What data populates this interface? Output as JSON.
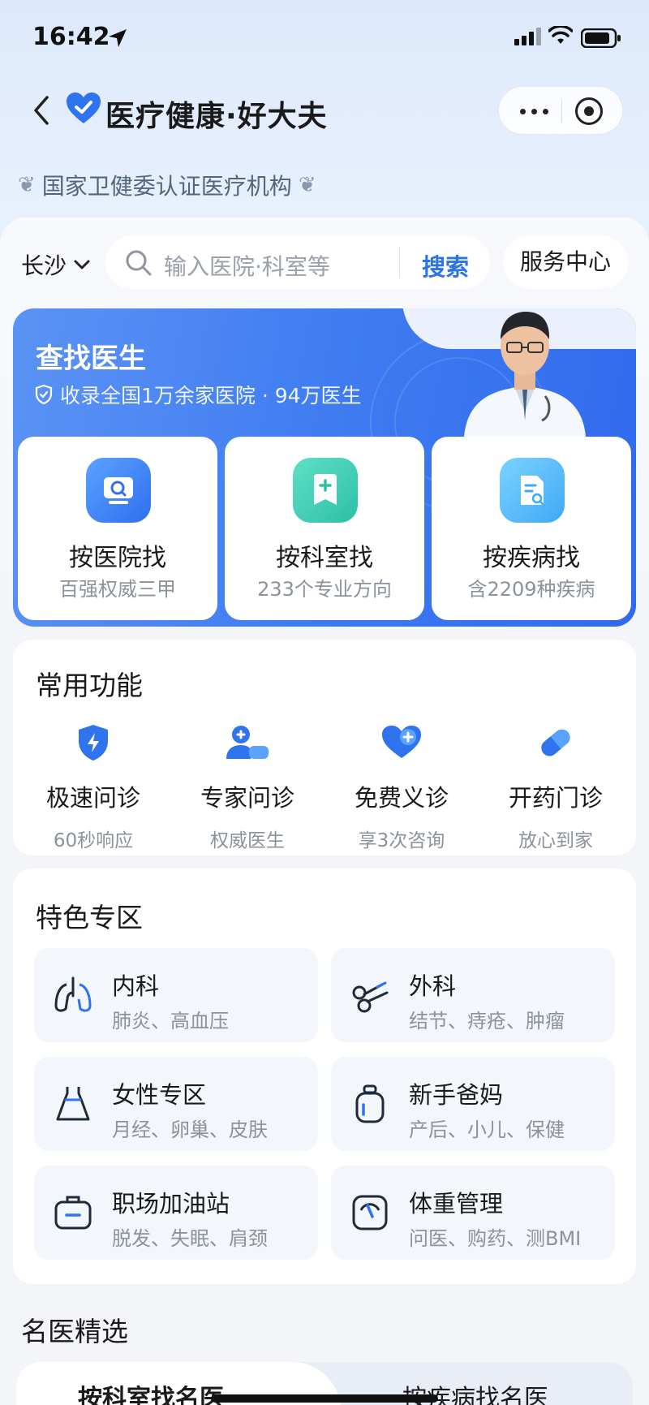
{
  "status_bar": {
    "time": "16:42"
  },
  "nav": {
    "brand": "医疗健康·好大夫"
  },
  "certification": "国家卫健委认证医疗机构",
  "search": {
    "city": "长沙",
    "placeholder": "输入医院·科室等",
    "button": "搜索",
    "service_center": "服务中心"
  },
  "find_doctor": {
    "title": "查找医生",
    "subtitle": "收录全国1万余家医院 · 94万医生",
    "tiles": [
      {
        "title": "按医院找",
        "sub": "百强权威三甲",
        "icon": "hospital-search-icon"
      },
      {
        "title": "按科室找",
        "sub": "233个专业方向",
        "icon": "department-icon"
      },
      {
        "title": "按疾病找",
        "sub": "含2209种疾病",
        "icon": "disease-document-icon"
      }
    ]
  },
  "common_functions": {
    "title": "常用功能",
    "items": [
      {
        "title": "极速问诊",
        "sub": "60秒响应",
        "icon": "lightning-shield-icon"
      },
      {
        "title": "专家问诊",
        "sub": "权威医生",
        "icon": "expert-chat-icon"
      },
      {
        "title": "免费义诊",
        "sub": "享3次咨询",
        "icon": "heart-plus-icon"
      },
      {
        "title": "开药门诊",
        "sub": "放心到家",
        "icon": "pill-icon"
      }
    ]
  },
  "special_zone": {
    "title": "特色专区",
    "items": [
      {
        "title": "内科",
        "sub": "肺炎、高血压",
        "icon": "lungs-icon"
      },
      {
        "title": "外科",
        "sub": "结节、痔疮、肿瘤",
        "icon": "scissors-icon"
      },
      {
        "title": "女性专区",
        "sub": "月经、卵巢、皮肤",
        "icon": "dress-icon"
      },
      {
        "title": "新手爸妈",
        "sub": "产后、小儿、保健",
        "icon": "baby-bottle-icon"
      },
      {
        "title": "职场加油站",
        "sub": "脱发、失眠、肩颈",
        "icon": "briefcase-icon"
      },
      {
        "title": "体重管理",
        "sub": "问医、购药、测BMI",
        "icon": "scale-icon"
      }
    ]
  },
  "top_doctors": {
    "title": "名医精选",
    "tabs": [
      "按科室找名医",
      "按疾病找名医"
    ]
  },
  "colors": {
    "accent": "#2a74e8",
    "card_blue": "#3f7cf1"
  }
}
